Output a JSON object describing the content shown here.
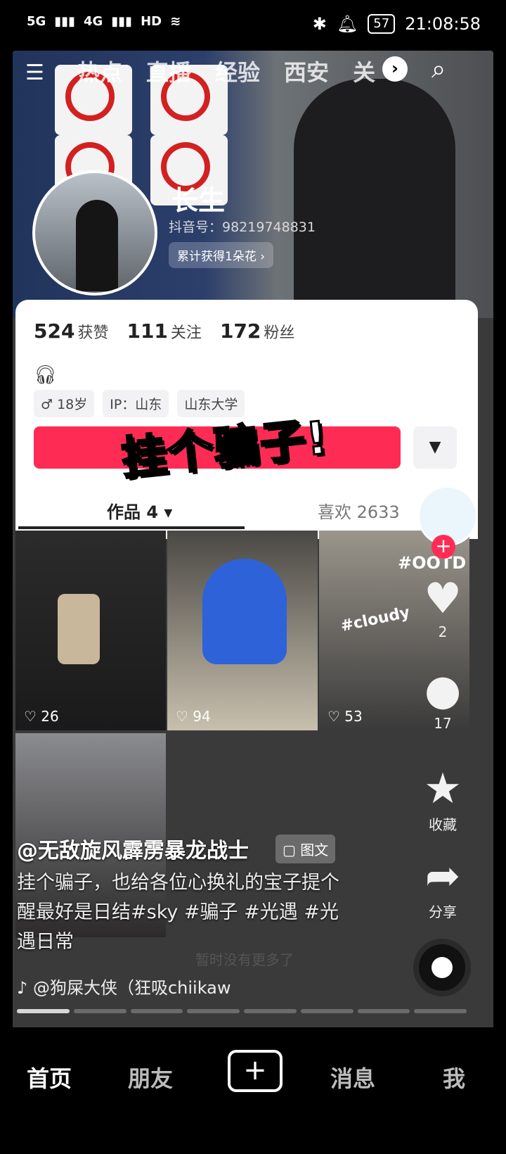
{
  "status": {
    "signal1": "5G",
    "signal2": "4G",
    "hd": "HD",
    "battery": "57",
    "time": "21:08:58"
  },
  "top_nav": {
    "tabs": [
      "热点",
      "直播",
      "经验",
      "西安",
      "关"
    ]
  },
  "profile": {
    "name": "长生",
    "douyin_id": "抖音号：98219748831",
    "flowers": "累计获得1朵花 ›",
    "stats": [
      {
        "value": "524",
        "label": "获赞"
      },
      {
        "value": "111",
        "label": "关注"
      },
      {
        "value": "172",
        "label": "粉丝"
      }
    ],
    "tags": [
      "♂ 18岁",
      "IP：山东",
      "山东大学"
    ],
    "overlay_text": "挂个骗子!",
    "tab_works": "作品 4 ▾",
    "tab_likes": "喜欢 2633",
    "grid_likes": [
      "26",
      "94",
      "53"
    ],
    "grid_labels": [
      "#OOTD",
      "#cloudy"
    ],
    "no_more": "暂时没有更多了"
  },
  "actions": {
    "like_count": "2",
    "comment_count": "17",
    "favorite_label": "收藏",
    "share_label": "分享"
  },
  "caption": {
    "author": "@无敌旋风霹雳暴龙战士",
    "badge": "图文",
    "text": "挂个骗子，也给各位心换礼的宝子提个醒最好是日结#sky #骗子 #光遇 #光遇日常",
    "music": "@狗屎大侠（狂吸chiikaw"
  },
  "bottom_nav": {
    "home": "首页",
    "friends": "朋友",
    "plus": "+",
    "messages": "消息",
    "me": "我"
  },
  "colors": {
    "accent": "#fe2c55",
    "background": "#000000"
  }
}
